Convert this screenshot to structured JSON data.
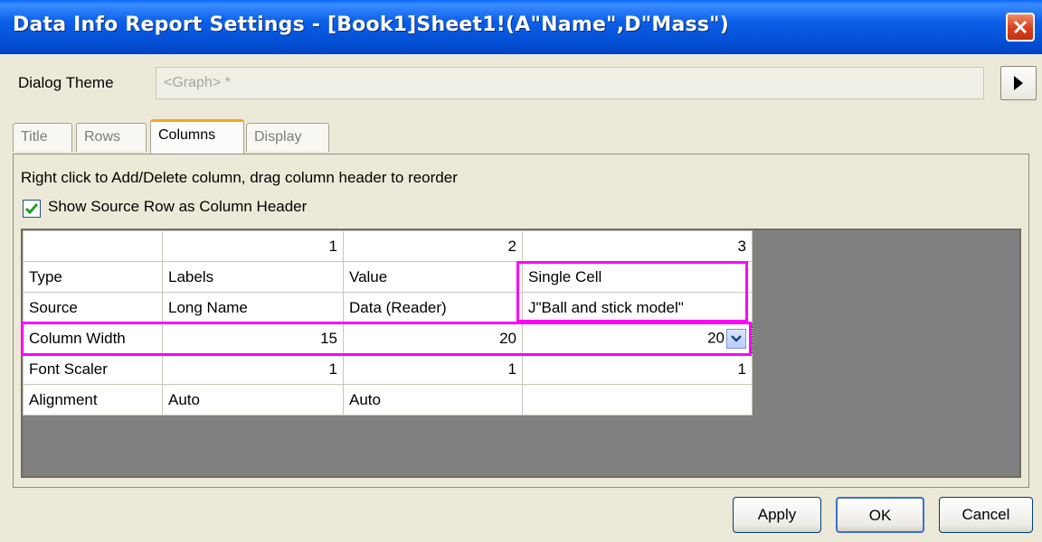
{
  "window": {
    "title": "Data Info Report Settings - [Book1]Sheet1!(A\"Name\",D\"Mass\")"
  },
  "theme": {
    "label": "Dialog Theme",
    "value": "<Graph> *"
  },
  "tabs": [
    {
      "label": "Title",
      "active": false
    },
    {
      "label": "Rows",
      "active": false
    },
    {
      "label": "Columns",
      "active": true
    },
    {
      "label": "Display",
      "active": false
    }
  ],
  "panel": {
    "hint": "Right click to Add/Delete column, drag column header to reorder",
    "show_source_row": {
      "label": "Show Source Row as Column Header",
      "checked": true
    }
  },
  "grid": {
    "headers": [
      "1",
      "2",
      "3"
    ],
    "rows": [
      {
        "label": "Type",
        "cells": [
          "Labels",
          "Value",
          "Single Cell"
        ]
      },
      {
        "label": "Source",
        "cells": [
          "Long Name",
          "Data (Reader)",
          "J\"Ball and stick model\""
        ]
      },
      {
        "label": "Column Width",
        "cells": [
          "15",
          "20",
          "20"
        ]
      },
      {
        "label": "Font Scaler",
        "cells": [
          "1",
          "1",
          "1"
        ]
      },
      {
        "label": "Alignment",
        "cells": [
          "Auto",
          "Auto",
          ""
        ]
      }
    ]
  },
  "buttons": {
    "apply": "Apply",
    "ok": "OK",
    "cancel": "Cancel"
  },
  "colors": {
    "highlight": "#ff00ff",
    "titlebar": "#0553d9",
    "grid_background": "#808080"
  }
}
